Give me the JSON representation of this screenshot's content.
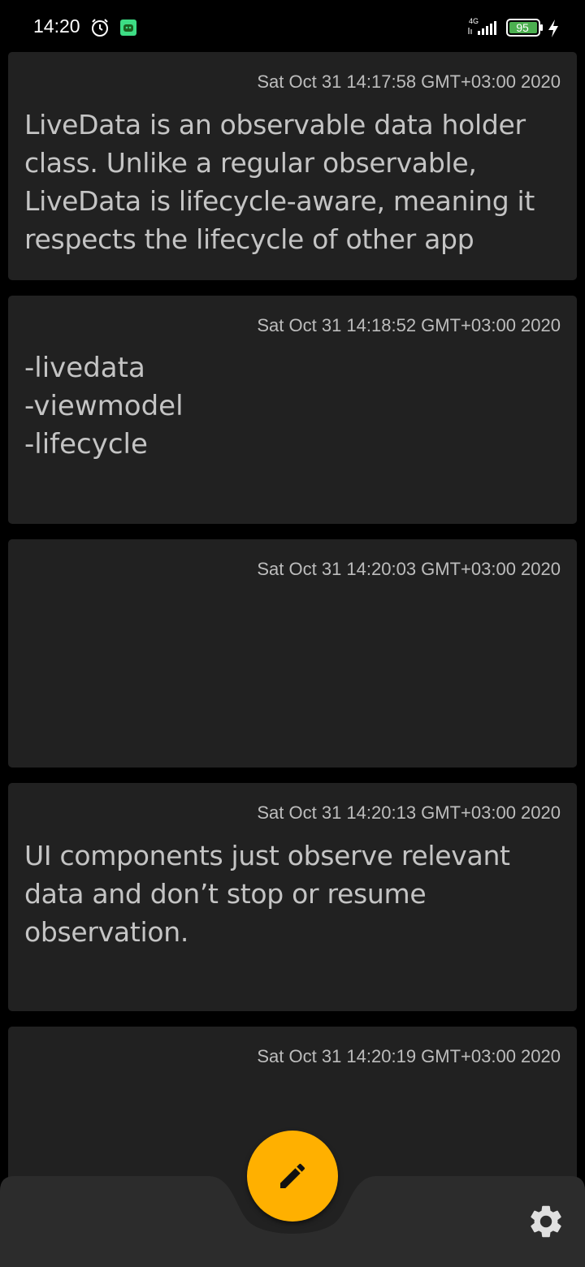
{
  "status_bar": {
    "time": "14:20",
    "network": "4G",
    "battery": "95"
  },
  "notes": [
    {
      "date": "Sat Oct 31 14:17:58 GMT+03:00 2020",
      "text": "LiveData is an observable data holder class. Unlike a regular observable, LiveData is lifecycle-aware, meaning it respects the lifecycle of other app"
    },
    {
      "date": "Sat Oct 31 14:18:52 GMT+03:00 2020",
      "text": "-livedata\n-viewmodel\n-lifecycle"
    },
    {
      "date": "Sat Oct 31 14:20:03 GMT+03:00 2020",
      "text": ""
    },
    {
      "date": "Sat Oct 31 14:20:13 GMT+03:00 2020",
      "text": "UI components just observe relevant data and don’t stop or resume observation."
    },
    {
      "date": "Sat Oct 31 14:20:19 GMT+03:00 2020",
      "text": ""
    }
  ],
  "fab": {
    "icon": "pencil-icon"
  },
  "settings": {
    "icon": "gear-icon"
  },
  "colors": {
    "background": "#000000",
    "card": "#212121",
    "accent": "#ffb000",
    "bottom_bar": "#2c2c2c"
  }
}
